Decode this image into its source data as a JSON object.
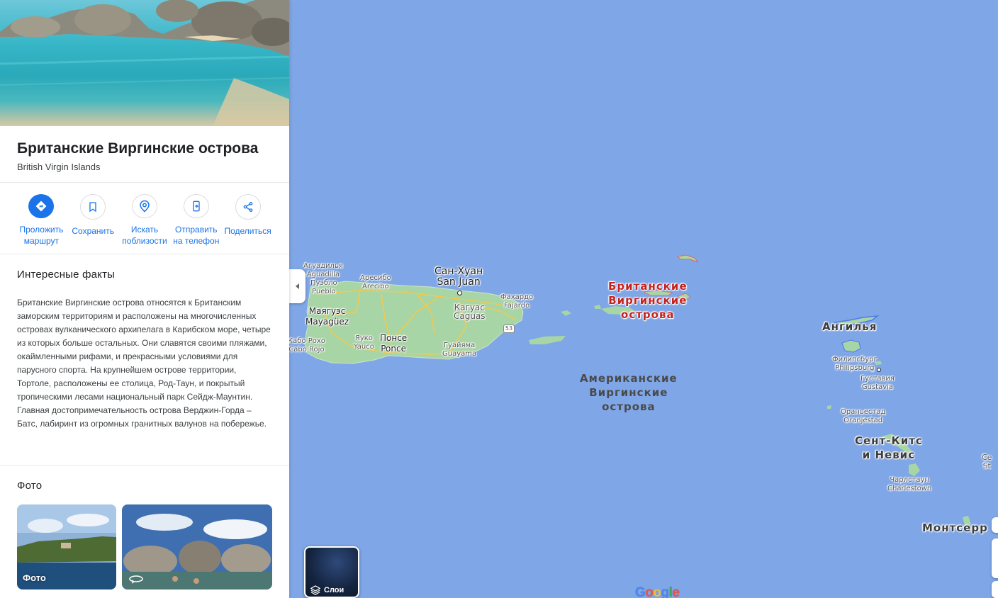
{
  "place": {
    "title": "Британские Виргинские острова",
    "subtitle": "British Virgin Islands"
  },
  "actions": [
    {
      "label": "Проложить\nмаршрут",
      "icon": "directions-icon"
    },
    {
      "label": "Сохранить",
      "icon": "bookmark-icon"
    },
    {
      "label": "Искать\nпоблизости",
      "icon": "search-nearby-icon"
    },
    {
      "label": "Отправить\nна телефон",
      "icon": "send-to-phone-icon"
    },
    {
      "label": "Поделиться",
      "icon": "share-icon"
    }
  ],
  "facts": {
    "heading": "Интересные факты",
    "text": "Британские Виргинские острова относятся к Британским заморским территориям и расположены на многочисленных островах вулканического архипелага в Карибском море, четыре из которых больше остальных. Они славятся своими пляжами, окаймленными рифами, и прекрасными условиями для парусного спорта. На крупнейшем острове территории, Тортоле, расположены ее столица, Род-Таун, и покрытый тропическими лесами национальный парк Сейдж-Маунтин. Главная достопримечательность острова Верджин-Горда – Батс, лабиринт из огромных гранитных валунов на побережье."
  },
  "photos": {
    "heading": "Фото",
    "items": [
      {
        "caption": "Фото"
      },
      {
        "caption": ""
      }
    ]
  },
  "map": {
    "layers_label": "Слои",
    "logo": "Google",
    "labels": {
      "aguadilla_ru": "Агуадилья",
      "aguadilla_en": "Aguadilla",
      "isabela_ru": "Пуэбло",
      "isabela_en": "Pueblo",
      "arecibo_ru": "Аресибо",
      "arecibo_en": "Arecibo",
      "sanjuan_ru": "Сан-Хуан",
      "sanjuan_en": "San Juan",
      "mayaguez_ru": "Маягуэс",
      "mayaguez_en": "Mayagüez",
      "caguas_ru": "Кагуас",
      "caguas_en": "Caguas",
      "fajardo_ru": "Фахардо",
      "fajardo_en": "Fajardo",
      "ponce_ru": "Понсе",
      "ponce_en": "Ponce",
      "yauco_ru": "Яуко",
      "yauco_en": "Yauco",
      "caborojo_ru": "Кабо Рохо",
      "caborojo_en": "Cabo Rojo",
      "guayama_ru": "Гуайяма",
      "guayama_en": "Guayama",
      "route": "53",
      "bvi": "Британские\nВиргинские\nострова",
      "usvi": "Американские\nВиргинские\nострова",
      "anguilla": "Ангилья",
      "philipsburg_ru": "Филипсбург",
      "philipsburg_en": "Philipsburg",
      "gustavia_ru": "Густавия",
      "gustavia_en": "Gustavia",
      "oranjestad_ru": "Ораньестад",
      "oranjestad_en": "Oranjestad",
      "stkitts": "Сент-Китс\nи Невис",
      "charlestown_ru": "Чарлстаун",
      "charlestown_en": "Charlestown",
      "montserrat": "Монтсерр",
      "edge_a": "Се",
      "edge_b": "St"
    }
  }
}
